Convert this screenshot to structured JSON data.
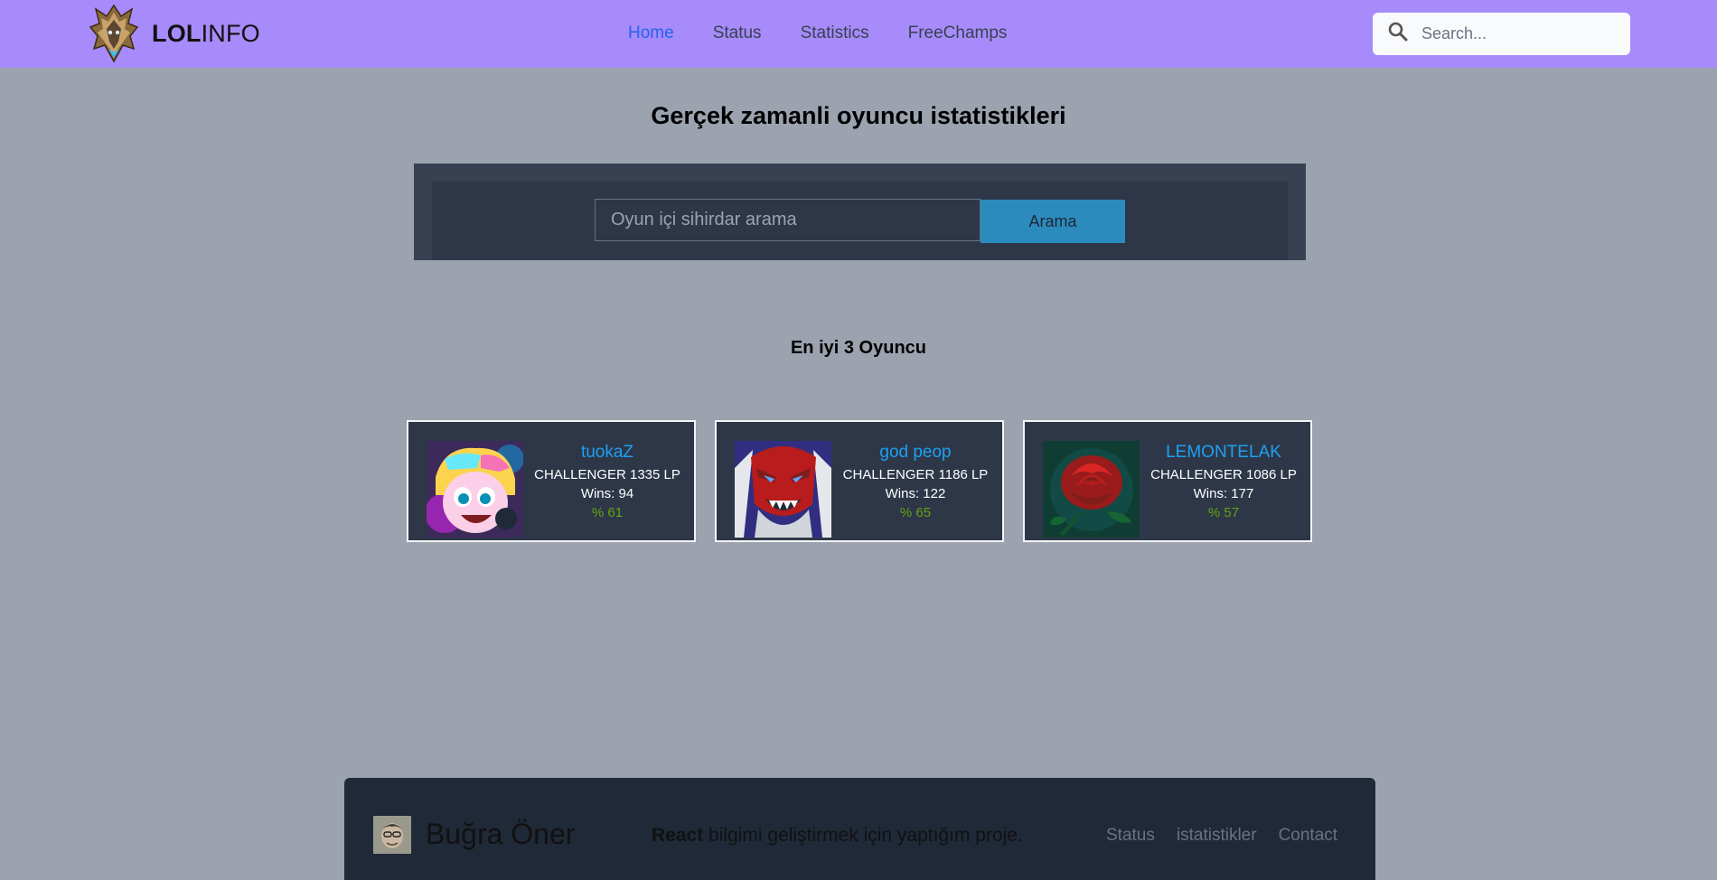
{
  "navbar": {
    "brand_bold": "LOL",
    "brand_rest": "INFO",
    "links": [
      "Home",
      "Status",
      "Statistics",
      "FreeChamps"
    ],
    "active_link": "Home",
    "search_placeholder": "Search...",
    "background": "#a78bfa",
    "active_color": "#2563eb"
  },
  "main": {
    "title": "Gerçek zamanli oyuncu istatistikleri",
    "summoner_search": {
      "placeholder": "Oyun içi sihirdar arama",
      "value": "",
      "button_label": "Arama",
      "button_color": "#2b8bbd"
    },
    "top_players_title": "En iyi 3 Oyuncu",
    "players": [
      {
        "name": "tuokaZ",
        "rank": "CHALLENGER 1335 LP",
        "wins": "Wins: 94",
        "winrate": "% 61",
        "icon": "champion-portrait-icon"
      },
      {
        "name": "god peop",
        "rank": "CHALLENGER 1186 LP",
        "wins": "Wins: 122",
        "winrate": "% 65",
        "icon": "demon-mask-icon"
      },
      {
        "name": "LEMONTELAK",
        "rank": "CHALLENGER 1086 LP",
        "wins": "Wins: 177",
        "winrate": "% 57",
        "icon": "rose-icon"
      }
    ],
    "name_color": "#1da1f2",
    "winrate_color": "#65a30d"
  },
  "footer": {
    "author": "Buğra Öner",
    "tagline_bold": "React",
    "tagline_rest": " bilgimi geliştirmek için yaptığım proje.",
    "links": [
      "Status",
      "istatistikler",
      "Contact"
    ]
  }
}
